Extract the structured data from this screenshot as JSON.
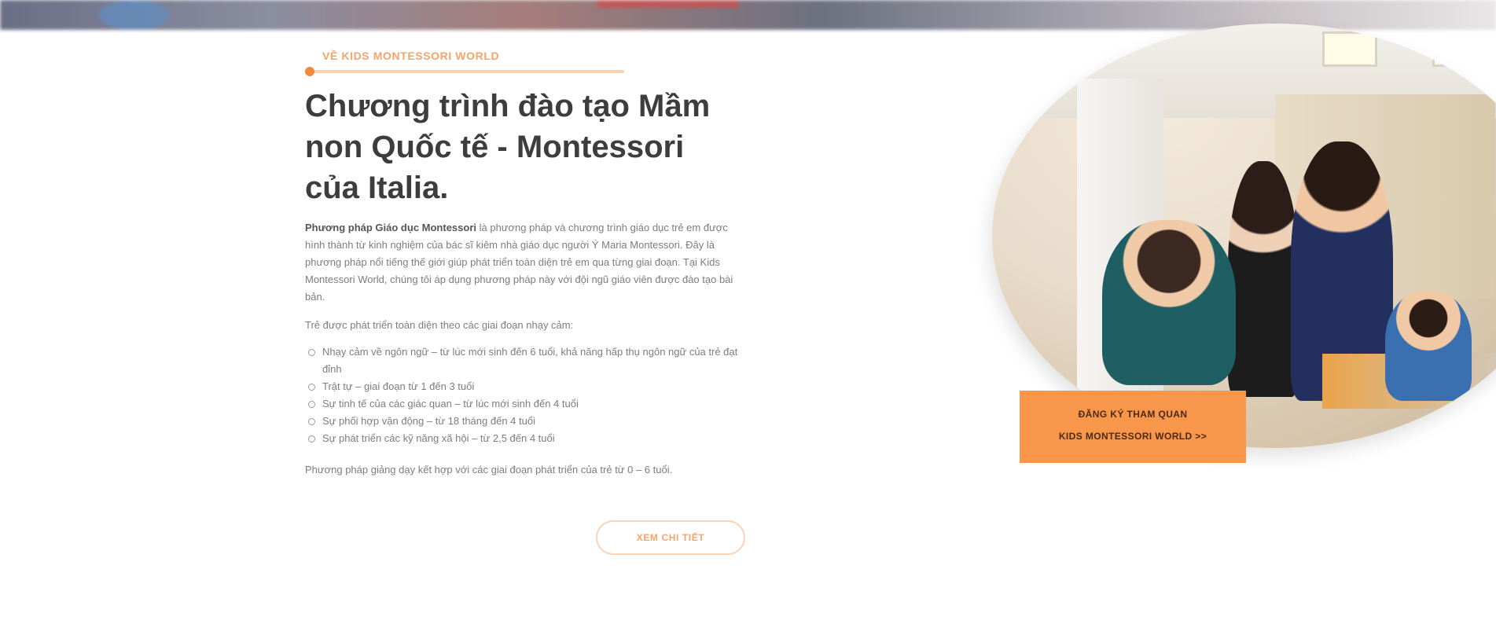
{
  "section": {
    "eyebrow": "Về Kids Montessori World",
    "title": "Chương trình đào tạo Mầm non Quốc tế - Montessori của Italia.",
    "intro_bold": "Phương pháp Giáo dục Montessori",
    "intro_rest": " là phương pháp và chương trình giáo dục trẻ em được hình thành từ kinh nghiệm của bác sĩ kiêm nhà giáo dục người Ý Maria Montessori. Đây là phương pháp nổi tiếng thế giới giúp phát triển toàn diện trẻ em qua từng giai đoạn. Tại Kids Montessori World, chúng tôi áp dụng phương pháp này với đội ngũ giáo viên được đào tạo bài bản.",
    "lead": "Trẻ được phát triển toàn diện theo các giai đoạn nhạy cảm:",
    "benefits": [
      "Nhạy cảm về ngôn ngữ – từ lúc mới sinh đến 6 tuổi, khả năng hấp thụ ngôn ngữ của trẻ đạt đỉnh",
      "Trật tự – giai đoạn từ 1 đến 3 tuổi",
      "Sự tinh tế của các giác quan – từ lúc mới sinh đến 4 tuổi",
      "Sự phối hợp vận động – từ 18 tháng đến 4 tuổi",
      "Sự phát triển các kỹ năng xã hội – từ 2,5 đến 4 tuổi"
    ],
    "closing": "Phương pháp giảng dạy kết hợp với các giai đoạn phát triển của trẻ từ 0 – 6 tuổi.",
    "more_button": "Xem chi tiết"
  },
  "photo": {
    "caption_line1": "Đăng ký tham quan",
    "caption_line2": "Kids Montessori World >>"
  },
  "colors": {
    "accent": "#f8964c",
    "accent_light": "#fbd1b3",
    "title": "#3d3d3d",
    "body": "#7d7d7d"
  }
}
